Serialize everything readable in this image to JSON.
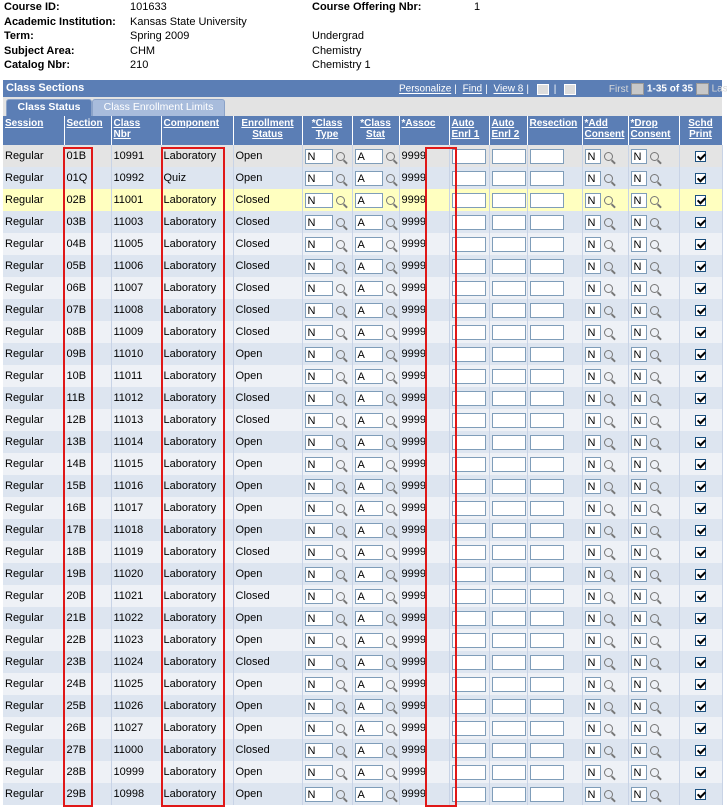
{
  "header": {
    "course_id_label": "Course ID:",
    "course_id": "101633",
    "offering_label": "Course Offering Nbr:",
    "offering": "1",
    "institution_label": "Academic Institution:",
    "institution": "Kansas State University",
    "term_label": "Term:",
    "term": "Spring 2009",
    "career": "Undergrad",
    "subject_label": "Subject Area:",
    "subject": "CHM",
    "subject_desc": "Chemistry",
    "catalog_label": "Catalog Nbr:",
    "catalog": "210",
    "catalog_desc": "Chemistry 1"
  },
  "section_bar": {
    "title": "Class Sections",
    "personalize": "Personalize",
    "find": "Find",
    "view": "View 8",
    "first": "First",
    "range": "1-35 of 35",
    "last": "Last"
  },
  "tabs": {
    "status": "Class Status",
    "enrollment": "Class Enrollment Limits"
  },
  "columns": {
    "session": "Session",
    "section": "Section",
    "class_nbr": "Class Nbr",
    "component": "Component",
    "enroll_status": "Enrollment Status",
    "class_type": "*Class Type",
    "class_stat": "*Class Stat",
    "assoc": "*Assoc",
    "auto1": "Auto Enrl 1",
    "auto2": "Auto Enrl 2",
    "resection": "Resection",
    "add_consent": "*Add Consent",
    "drop_consent": "*Drop Consent",
    "schd_print": "Schd Print"
  },
  "rows": [
    {
      "session": "Regular",
      "section": "01B",
      "nbr": "10991",
      "comp": "Laboratory",
      "status": "Open",
      "type": "N",
      "stat": "A",
      "assoc": "9999",
      "add": "N",
      "drop": "N"
    },
    {
      "session": "Regular",
      "section": "01Q",
      "nbr": "10992",
      "comp": "Quiz",
      "status": "Open",
      "type": "N",
      "stat": "A",
      "assoc": "9999",
      "add": "N",
      "drop": "N"
    },
    {
      "session": "Regular",
      "section": "02B",
      "nbr": "11001",
      "comp": "Laboratory",
      "status": "Closed",
      "type": "N",
      "stat": "A",
      "assoc": "9999",
      "add": "N",
      "drop": "N"
    },
    {
      "session": "Regular",
      "section": "03B",
      "nbr": "11003",
      "comp": "Laboratory",
      "status": "Closed",
      "type": "N",
      "stat": "A",
      "assoc": "9999",
      "add": "N",
      "drop": "N"
    },
    {
      "session": "Regular",
      "section": "04B",
      "nbr": "11005",
      "comp": "Laboratory",
      "status": "Closed",
      "type": "N",
      "stat": "A",
      "assoc": "9999",
      "add": "N",
      "drop": "N"
    },
    {
      "session": "Regular",
      "section": "05B",
      "nbr": "11006",
      "comp": "Laboratory",
      "status": "Closed",
      "type": "N",
      "stat": "A",
      "assoc": "9999",
      "add": "N",
      "drop": "N"
    },
    {
      "session": "Regular",
      "section": "06B",
      "nbr": "11007",
      "comp": "Laboratory",
      "status": "Closed",
      "type": "N",
      "stat": "A",
      "assoc": "9999",
      "add": "N",
      "drop": "N"
    },
    {
      "session": "Regular",
      "section": "07B",
      "nbr": "11008",
      "comp": "Laboratory",
      "status": "Closed",
      "type": "N",
      "stat": "A",
      "assoc": "9999",
      "add": "N",
      "drop": "N"
    },
    {
      "session": "Regular",
      "section": "08B",
      "nbr": "11009",
      "comp": "Laboratory",
      "status": "Closed",
      "type": "N",
      "stat": "A",
      "assoc": "9999",
      "add": "N",
      "drop": "N"
    },
    {
      "session": "Regular",
      "section": "09B",
      "nbr": "11010",
      "comp": "Laboratory",
      "status": "Open",
      "type": "N",
      "stat": "A",
      "assoc": "9999",
      "add": "N",
      "drop": "N"
    },
    {
      "session": "Regular",
      "section": "10B",
      "nbr": "11011",
      "comp": "Laboratory",
      "status": "Open",
      "type": "N",
      "stat": "A",
      "assoc": "9999",
      "add": "N",
      "drop": "N"
    },
    {
      "session": "Regular",
      "section": "11B",
      "nbr": "11012",
      "comp": "Laboratory",
      "status": "Closed",
      "type": "N",
      "stat": "A",
      "assoc": "9999",
      "add": "N",
      "drop": "N"
    },
    {
      "session": "Regular",
      "section": "12B",
      "nbr": "11013",
      "comp": "Laboratory",
      "status": "Closed",
      "type": "N",
      "stat": "A",
      "assoc": "9999",
      "add": "N",
      "drop": "N"
    },
    {
      "session": "Regular",
      "section": "13B",
      "nbr": "11014",
      "comp": "Laboratory",
      "status": "Open",
      "type": "N",
      "stat": "A",
      "assoc": "9999",
      "add": "N",
      "drop": "N"
    },
    {
      "session": "Regular",
      "section": "14B",
      "nbr": "11015",
      "comp": "Laboratory",
      "status": "Open",
      "type": "N",
      "stat": "A",
      "assoc": "9999",
      "add": "N",
      "drop": "N"
    },
    {
      "session": "Regular",
      "section": "15B",
      "nbr": "11016",
      "comp": "Laboratory",
      "status": "Open",
      "type": "N",
      "stat": "A",
      "assoc": "9999",
      "add": "N",
      "drop": "N"
    },
    {
      "session": "Regular",
      "section": "16B",
      "nbr": "11017",
      "comp": "Laboratory",
      "status": "Open",
      "type": "N",
      "stat": "A",
      "assoc": "9999",
      "add": "N",
      "drop": "N"
    },
    {
      "session": "Regular",
      "section": "17B",
      "nbr": "11018",
      "comp": "Laboratory",
      "status": "Open",
      "type": "N",
      "stat": "A",
      "assoc": "9999",
      "add": "N",
      "drop": "N"
    },
    {
      "session": "Regular",
      "section": "18B",
      "nbr": "11019",
      "comp": "Laboratory",
      "status": "Closed",
      "type": "N",
      "stat": "A",
      "assoc": "9999",
      "add": "N",
      "drop": "N"
    },
    {
      "session": "Regular",
      "section": "19B",
      "nbr": "11020",
      "comp": "Laboratory",
      "status": "Open",
      "type": "N",
      "stat": "A",
      "assoc": "9999",
      "add": "N",
      "drop": "N"
    },
    {
      "session": "Regular",
      "section": "20B",
      "nbr": "11021",
      "comp": "Laboratory",
      "status": "Closed",
      "type": "N",
      "stat": "A",
      "assoc": "9999",
      "add": "N",
      "drop": "N"
    },
    {
      "session": "Regular",
      "section": "21B",
      "nbr": "11022",
      "comp": "Laboratory",
      "status": "Open",
      "type": "N",
      "stat": "A",
      "assoc": "9999",
      "add": "N",
      "drop": "N"
    },
    {
      "session": "Regular",
      "section": "22B",
      "nbr": "11023",
      "comp": "Laboratory",
      "status": "Open",
      "type": "N",
      "stat": "A",
      "assoc": "9999",
      "add": "N",
      "drop": "N"
    },
    {
      "session": "Regular",
      "section": "23B",
      "nbr": "11024",
      "comp": "Laboratory",
      "status": "Closed",
      "type": "N",
      "stat": "A",
      "assoc": "9999",
      "add": "N",
      "drop": "N"
    },
    {
      "session": "Regular",
      "section": "24B",
      "nbr": "11025",
      "comp": "Laboratory",
      "status": "Open",
      "type": "N",
      "stat": "A",
      "assoc": "9999",
      "add": "N",
      "drop": "N"
    },
    {
      "session": "Regular",
      "section": "25B",
      "nbr": "11026",
      "comp": "Laboratory",
      "status": "Open",
      "type": "N",
      "stat": "A",
      "assoc": "9999",
      "add": "N",
      "drop": "N"
    },
    {
      "session": "Regular",
      "section": "26B",
      "nbr": "11027",
      "comp": "Laboratory",
      "status": "Open",
      "type": "N",
      "stat": "A",
      "assoc": "9999",
      "add": "N",
      "drop": "N"
    },
    {
      "session": "Regular",
      "section": "27B",
      "nbr": "11000",
      "comp": "Laboratory",
      "status": "Closed",
      "type": "N",
      "stat": "A",
      "assoc": "9999",
      "add": "N",
      "drop": "N"
    },
    {
      "session": "Regular",
      "section": "28B",
      "nbr": "10999",
      "comp": "Laboratory",
      "status": "Open",
      "type": "N",
      "stat": "A",
      "assoc": "9999",
      "add": "N",
      "drop": "N"
    },
    {
      "session": "Regular",
      "section": "29B",
      "nbr": "10998",
      "comp": "Laboratory",
      "status": "Open",
      "type": "N",
      "stat": "A",
      "assoc": "9999",
      "add": "N",
      "drop": "N"
    }
  ],
  "colors": {
    "header_blue": "#5b7eb5",
    "highlight": "#ffffc0",
    "annotation_red": "#e01818"
  }
}
